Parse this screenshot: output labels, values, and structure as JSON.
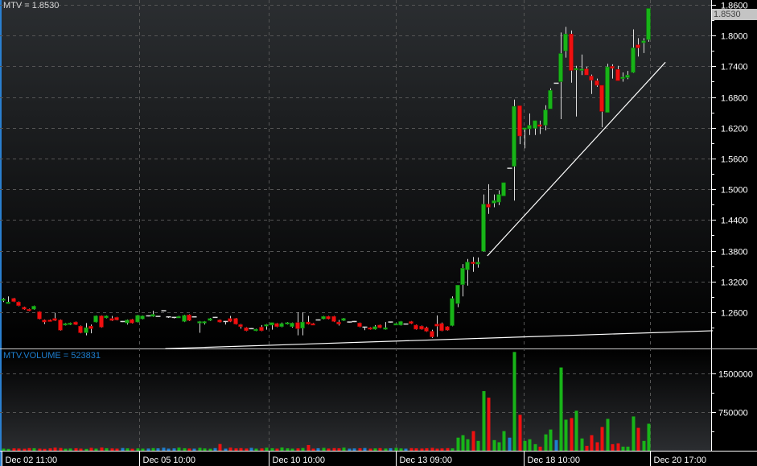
{
  "chart_data": [
    {
      "type": "candlestick",
      "title": "MTV = 1.8530",
      "symbol": "MTV",
      "last_price_label": "1.8530",
      "ylim": [
        1.2,
        1.866
      ],
      "yticks": [
        "1.8600",
        "1.8000",
        "1.7400",
        "1.6800",
        "1.6200",
        "1.5600",
        "1.5000",
        "1.4400",
        "1.3800",
        "1.3200",
        "1.2600"
      ],
      "ytick_values": [
        1.86,
        1.8,
        1.74,
        1.68,
        1.62,
        1.56,
        1.5,
        1.44,
        1.38,
        1.32,
        1.26
      ],
      "grid": true,
      "columns": [
        "open",
        "high",
        "low",
        "close"
      ],
      "candles": [
        [
          1.283,
          1.288,
          1.28,
          1.286
        ],
        [
          1.279,
          1.291,
          1.278,
          1.28
        ],
        [
          1.287,
          1.288,
          1.28,
          1.281
        ],
        [
          1.28,
          1.281,
          1.272,
          1.273
        ],
        [
          1.27,
          1.271,
          1.265,
          1.266
        ],
        [
          1.266,
          1.267,
          1.262,
          1.263
        ],
        [
          1.266,
          1.273,
          1.265,
          1.272
        ],
        [
          1.261,
          1.262,
          1.246,
          1.247
        ],
        [
          1.245,
          1.246,
          1.237,
          1.241
        ],
        [
          1.245,
          1.246,
          1.242,
          1.243
        ],
        [
          1.248,
          1.259,
          1.243,
          1.244
        ],
        [
          1.245,
          1.246,
          1.224,
          1.225
        ],
        [
          1.235,
          1.239,
          1.234,
          1.238
        ],
        [
          1.236,
          1.24,
          1.235,
          1.239
        ],
        [
          1.241,
          1.242,
          1.235,
          1.236
        ],
        [
          1.233,
          1.234,
          1.219,
          1.22
        ],
        [
          1.22,
          1.239,
          1.215,
          1.23
        ],
        [
          1.233,
          1.236,
          1.219,
          1.228
        ],
        [
          1.241,
          1.254,
          1.24,
          1.253
        ],
        [
          1.253,
          1.254,
          1.23,
          1.231
        ],
        [
          1.249,
          1.254,
          1.248,
          1.253
        ],
        [
          1.248,
          1.253,
          1.243,
          1.244
        ],
        [
          1.25,
          1.251,
          1.244,
          1.245
        ],
        [
          1.242,
          1.243,
          1.241,
          1.242
        ],
        [
          1.239,
          1.246,
          1.236,
          1.245
        ],
        [
          1.246,
          1.247,
          1.238,
          1.239
        ],
        [
          1.241,
          1.255,
          1.24,
          1.254
        ],
        [
          1.247,
          1.254,
          1.246,
          1.253
        ],
        [
          1.253,
          1.254,
          1.252,
          1.253
        ],
        [
          1.252,
          1.263,
          1.251,
          1.256
        ],
        [
          1.252,
          1.253,
          1.251,
          1.252
        ],
        [
          1.263,
          1.263,
          1.263,
          1.263
        ],
        [
          1.251,
          1.252,
          1.249,
          1.251
        ],
        [
          1.25,
          1.251,
          1.248,
          1.25
        ],
        [
          1.25,
          1.253,
          1.249,
          1.252
        ],
        [
          1.242,
          1.255,
          1.241,
          1.254
        ],
        [
          1.255,
          1.256,
          1.243,
          1.244
        ],
        [
          1.251,
          1.252,
          1.25,
          1.251
        ],
        [
          1.241,
          1.243,
          1.22,
          1.242
        ],
        [
          1.239,
          1.243,
          1.236,
          1.242
        ],
        [
          1.244,
          1.249,
          1.243,
          1.248
        ],
        [
          1.25,
          1.251,
          1.249,
          1.25
        ],
        [
          1.245,
          1.246,
          1.24,
          1.241
        ],
        [
          1.242,
          1.243,
          1.236,
          1.242
        ],
        [
          1.248,
          1.253,
          1.241,
          1.242
        ],
        [
          1.248,
          1.249,
          1.236,
          1.237
        ],
        [
          1.236,
          1.237,
          1.228,
          1.232
        ],
        [
          1.23,
          1.231,
          1.223,
          1.224
        ],
        [
          1.228,
          1.229,
          1.227,
          1.228
        ],
        [
          1.224,
          1.228,
          1.223,
          1.227
        ],
        [
          1.231,
          1.235,
          1.223,
          1.224
        ],
        [
          1.233,
          1.237,
          1.226,
          1.236
        ],
        [
          1.235,
          1.24,
          1.226,
          1.24
        ],
        [
          1.238,
          1.239,
          1.231,
          1.232
        ],
        [
          1.232,
          1.24,
          1.231,
          1.238
        ],
        [
          1.237,
          1.241,
          1.236,
          1.24
        ],
        [
          1.232,
          1.24,
          1.23,
          1.239
        ],
        [
          1.24,
          1.26,
          1.215,
          1.228
        ],
        [
          1.229,
          1.26,
          1.215,
          1.241
        ],
        [
          1.241,
          1.253,
          1.236,
          1.237
        ],
        [
          1.238,
          1.239,
          1.235,
          1.236
        ],
        [
          1.245,
          1.246,
          1.244,
          1.245
        ],
        [
          1.247,
          1.253,
          1.246,
          1.252
        ],
        [
          1.252,
          1.253,
          1.246,
          1.247
        ],
        [
          1.252,
          1.253,
          1.241,
          1.242
        ],
        [
          1.241,
          1.245,
          1.234,
          1.237
        ],
        [
          1.244,
          1.249,
          1.243,
          1.248
        ],
        [
          1.241,
          1.242,
          1.24,
          1.241
        ],
        [
          1.242,
          1.243,
          1.241,
          1.242
        ],
        [
          1.239,
          1.24,
          1.231,
          1.232
        ],
        [
          1.231,
          1.232,
          1.225,
          1.231
        ],
        [
          1.23,
          1.231,
          1.226,
          1.227
        ],
        [
          1.227,
          1.235,
          1.226,
          1.232
        ],
        [
          1.235,
          1.236,
          1.229,
          1.23
        ],
        [
          1.227,
          1.241,
          1.226,
          1.23
        ],
        [
          1.241,
          1.242,
          1.24,
          1.241
        ],
        [
          1.236,
          1.239,
          1.235,
          1.238
        ],
        [
          1.235,
          1.243,
          1.234,
          1.242
        ],
        [
          1.237,
          1.238,
          1.236,
          1.237
        ],
        [
          1.242,
          1.243,
          1.237,
          1.238
        ],
        [
          1.235,
          1.236,
          1.226,
          1.227
        ],
        [
          1.233,
          1.234,
          1.226,
          1.227
        ],
        [
          1.23,
          1.232,
          1.222,
          1.223
        ],
        [
          1.223,
          1.226,
          1.21,
          1.212
        ],
        [
          1.237,
          1.254,
          1.212,
          1.233
        ],
        [
          1.238,
          1.24,
          1.223,
          1.224
        ],
        [
          1.232,
          1.233,
          1.224,
          1.225
        ],
        [
          1.234,
          1.291,
          1.233,
          1.287
        ],
        [
          1.277,
          1.313,
          1.27,
          1.313
        ],
        [
          1.314,
          1.354,
          1.291,
          1.346
        ],
        [
          1.343,
          1.364,
          1.312,
          1.358
        ],
        [
          1.358,
          1.368,
          1.339,
          1.356
        ],
        [
          1.354,
          1.367,
          1.347,
          1.358
        ],
        [
          1.379,
          1.49,
          1.378,
          1.471
        ],
        [
          1.471,
          1.51,
          1.452,
          1.465
        ],
        [
          1.473,
          1.49,
          1.465,
          1.478
        ],
        [
          1.475,
          1.498,
          1.469,
          1.49
        ],
        [
          1.487,
          1.513,
          1.487,
          1.513
        ],
        [
          1.541,
          1.541,
          1.541,
          1.541
        ],
        [
          1.545,
          1.675,
          1.478,
          1.662
        ],
        [
          1.663,
          1.663,
          1.588,
          1.604
        ],
        [
          1.618,
          1.62,
          1.58,
          1.62
        ],
        [
          1.618,
          1.648,
          1.606,
          1.625
        ],
        [
          1.619,
          1.634,
          1.606,
          1.634
        ],
        [
          1.626,
          1.634,
          1.608,
          1.623
        ],
        [
          1.625,
          1.664,
          1.615,
          1.655
        ],
        [
          1.657,
          1.697,
          1.657,
          1.693
        ],
        [
          1.707,
          1.707,
          1.707,
          1.707
        ],
        [
          1.71,
          1.806,
          1.637,
          1.765
        ],
        [
          1.77,
          1.817,
          1.757,
          1.803
        ],
        [
          1.803,
          1.81,
          1.708,
          1.732
        ],
        [
          1.733,
          1.741,
          1.642,
          1.736
        ],
        [
          1.732,
          1.763,
          1.723,
          1.735
        ],
        [
          1.735,
          1.739,
          1.723,
          1.723
        ],
        [
          1.721,
          1.724,
          1.686,
          1.713
        ],
        [
          1.712,
          1.716,
          1.7,
          1.703
        ],
        [
          1.703,
          1.703,
          1.621,
          1.652
        ],
        [
          1.65,
          1.745,
          1.65,
          1.739
        ],
        [
          1.74,
          1.744,
          1.716,
          1.736
        ],
        [
          1.734,
          1.741,
          1.712,
          1.712
        ],
        [
          1.716,
          1.728,
          1.71,
          1.719
        ],
        [
          1.718,
          1.731,
          1.715,
          1.723
        ],
        [
          1.728,
          1.812,
          1.727,
          1.776
        ],
        [
          1.782,
          1.795,
          1.759,
          1.776
        ],
        [
          1.786,
          1.795,
          1.766,
          1.79
        ],
        [
          1.792,
          1.853,
          1.788,
          1.853
        ]
      ],
      "trendlines": [
        {
          "from_index": 31.4,
          "from_price": 1.189,
          "to_index": 137.5,
          "to_price": 1.224
        },
        {
          "from_index": 93.8,
          "from_price": 1.37,
          "to_index": 128.3,
          "to_price": 1.748
        }
      ],
      "colors": {
        "up": "#18b418",
        "down": "#f01010",
        "neutral": "#1e7fd0",
        "doji": "#d0d0d0"
      }
    },
    {
      "type": "bar",
      "title": "MTV.VOLUME = 523831",
      "ylim": [
        0,
        2000000
      ],
      "yticks": [
        "1500000",
        "750000"
      ],
      "ytick_values": [
        1500000,
        750000
      ],
      "grid": true,
      "values": [
        40000,
        35000,
        45000,
        42000,
        38000,
        50000,
        48000,
        40000,
        36000,
        45000,
        60000,
        52000,
        38000,
        42000,
        48000,
        40000,
        35000,
        55000,
        40000,
        62000,
        48000,
        44000,
        40000,
        52000,
        46000,
        38000,
        45000,
        40000,
        42000,
        50000,
        46000,
        58000,
        40000,
        45000,
        60000,
        48000,
        42000,
        40000,
        55000,
        44000,
        38000,
        50000,
        130000,
        40000,
        60000,
        45000,
        50000,
        42000,
        55000,
        40000,
        44000,
        58000,
        48000,
        40000,
        62000,
        46000,
        40000,
        45000,
        52000,
        110000,
        40000,
        48000,
        55000,
        42000,
        50000,
        46000,
        60000,
        40000,
        44000,
        48000,
        52000,
        40000,
        45000,
        50000,
        42000,
        48000,
        56000,
        44000,
        40000,
        50000,
        46000,
        42000,
        48000,
        55000,
        40000,
        44000,
        50000,
        45000,
        254000,
        301000,
        222000,
        380000,
        190000,
        1157000,
        1030000,
        206000,
        164000,
        380000,
        254000,
        1917000,
        697000,
        190000,
        222000,
        127000,
        79000,
        317000,
        412000,
        206000,
        1616000,
        602000,
        634000,
        776000,
        238000,
        95000,
        301000,
        164000,
        460000,
        618000,
        127000,
        143000,
        79000,
        79000,
        665000,
        444000,
        190000,
        523831
      ]
    }
  ],
  "x_axis": {
    "labels": [
      "Dec 02 11:00",
      "Dec 05 10:00",
      "Dec 10 10:00",
      "Dec 13 09:00",
      "Dec 18 10:00",
      "Dec 20 17:00"
    ],
    "label_indices": [
      1.7,
      26.4,
      51.4,
      76.1,
      100.8,
      125.3
    ]
  }
}
